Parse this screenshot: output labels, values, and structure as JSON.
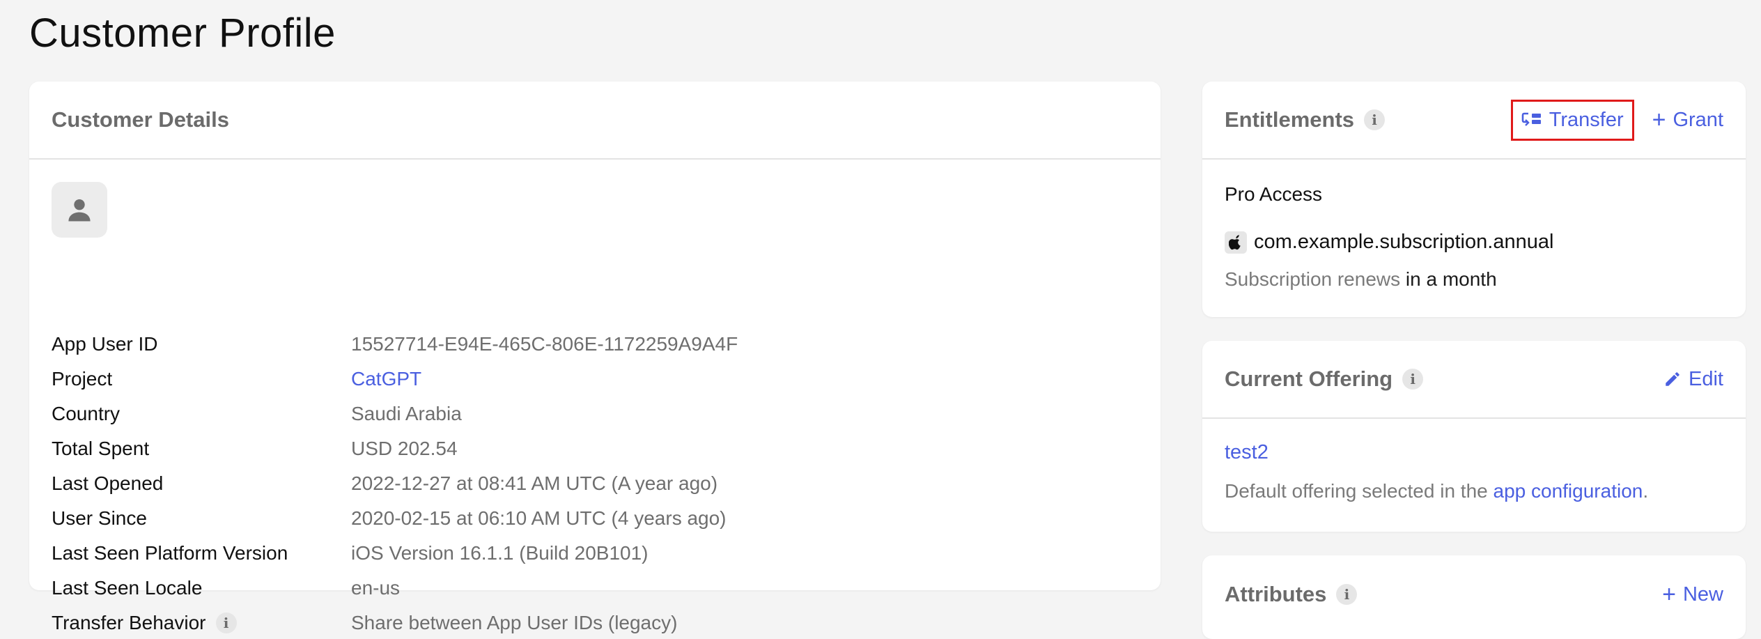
{
  "page": {
    "title": "Customer Profile"
  },
  "details": {
    "title": "Customer Details",
    "rows": [
      {
        "label": "App User ID",
        "value": "15527714-E94E-465C-806E-1172259A9A4F",
        "link": false
      },
      {
        "label": "Project",
        "value": "CatGPT",
        "link": true
      },
      {
        "label": "Country",
        "value": "Saudi Arabia",
        "link": false
      },
      {
        "label": "Total Spent",
        "value": "USD 202.54",
        "link": false
      },
      {
        "label": "Last Opened",
        "value": "2022-12-27 at 08:41 AM UTC (A year ago)",
        "link": false
      },
      {
        "label": "User Since",
        "value": "2020-02-15 at 06:10 AM UTC (4 years ago)",
        "link": false
      },
      {
        "label": "Last Seen Platform Version",
        "value": "iOS Version 16.1.1 (Build 20B101)",
        "link": false
      },
      {
        "label": "Last Seen Locale",
        "value": "en-us",
        "link": false
      },
      {
        "label": "Transfer Behavior",
        "value": "Share between App User IDs (legacy)",
        "link": false
      }
    ]
  },
  "entitlements": {
    "title": "Entitlements",
    "transfer_label": "Transfer",
    "grant_label": "Grant",
    "entitlement_name": "Pro Access",
    "product_id": "com.example.subscription.annual",
    "renew_prefix": "Subscription renews",
    "renew_when": "in a month"
  },
  "offering": {
    "title": "Current Offering",
    "edit_label": "Edit",
    "offering_id": "test2",
    "desc_prefix": "Default offering selected in the",
    "desc_link": "app configuration",
    "desc_suffix": "."
  },
  "attributes": {
    "title": "Attributes",
    "new_label": "New"
  },
  "colors": {
    "accent": "#4a5fe0",
    "highlight": "#e01a1a",
    "background": "#f4f4f4"
  }
}
